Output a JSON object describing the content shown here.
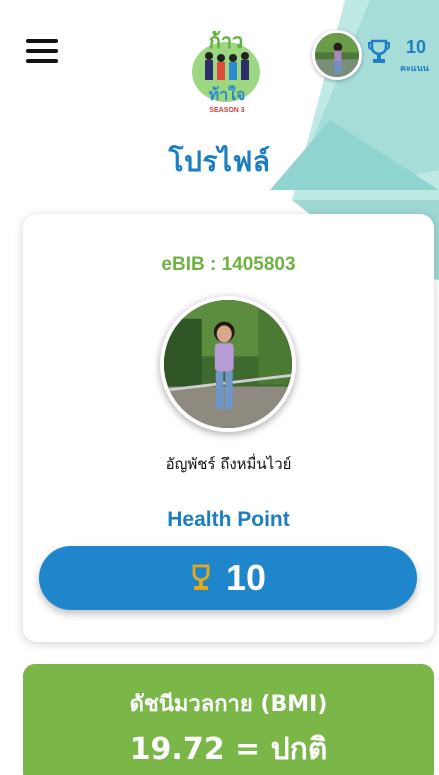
{
  "header": {
    "menu_icon": "hamburger-menu-icon",
    "logo_label": "ก้าวท้าใจ",
    "logo_season": "SEASON 3",
    "points_value": "10",
    "points_unit": "คะแนน",
    "trophy_icon": "trophy-icon"
  },
  "page": {
    "title": "โปรไฟล์"
  },
  "profile": {
    "ebib": "eBIB : 1405803",
    "name": "อัญพัชร์ ถึงหมื่นไวย์",
    "health_point_label": "Health Point",
    "health_point_value": "10"
  },
  "bmi": {
    "title": "ดัชนีมวลกาย (BMI)",
    "value": "19.72 = ปกติ"
  },
  "colors": {
    "primary_blue": "#1f86cc",
    "title_blue": "#1b7ec2",
    "green": "#7ab648",
    "ebib_green": "#6db33f",
    "teal_shape": "#8fd4cf",
    "trophy_gold": "#e6a817"
  }
}
